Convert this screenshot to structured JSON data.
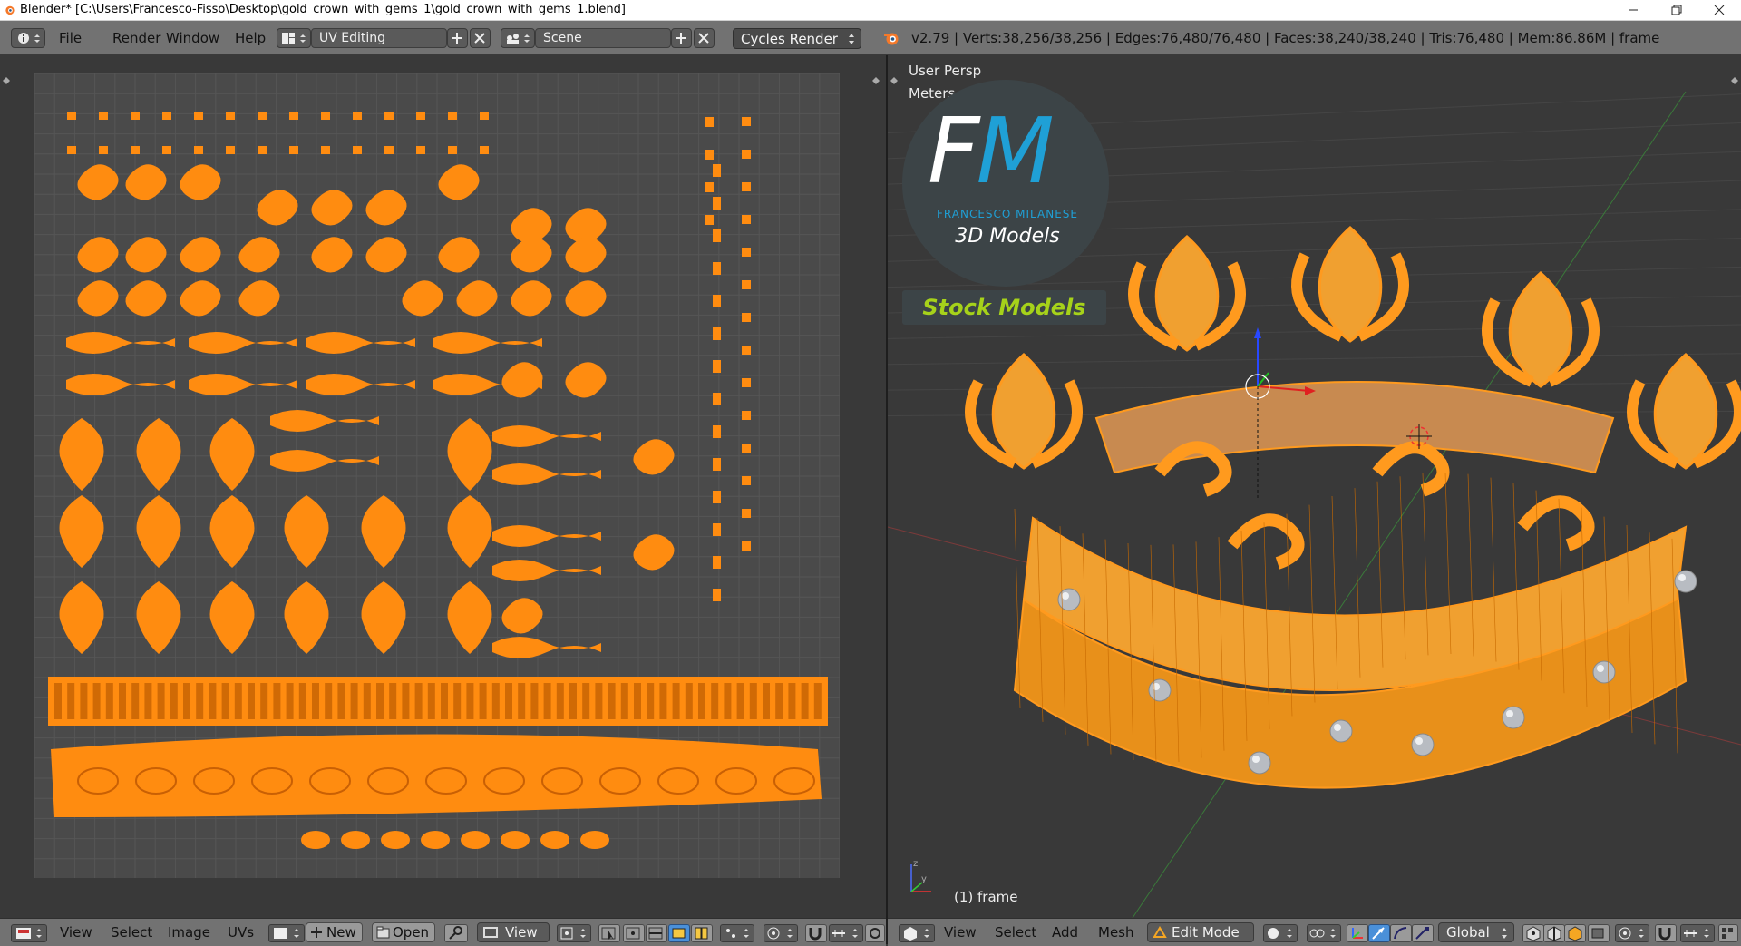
{
  "window": {
    "title": "Blender* [C:\\Users\\Francesco-Fisso\\Desktop\\gold_crown_with_gems_1\\gold_crown_with_gems_1.blend]"
  },
  "info_header": {
    "menus": [
      "File",
      "Render",
      "Window",
      "Help"
    ],
    "screen_layout": "UV Editing",
    "scene": "Scene",
    "render_engine": "Cycles Render",
    "stats": "v2.79 | Verts:38,256/38,256 | Edges:76,480/76,480 | Faces:38,240/38,240 | Tris:76,480 | Mem:86.86M | frame"
  },
  "viewport": {
    "view_name": "User Persp",
    "units": "Meters",
    "object_label": "(1) frame"
  },
  "watermark": {
    "letters_f": "F",
    "letters_m": "M",
    "author": "FRANCESCO MILANESE",
    "subtitle": "3D Models",
    "badge": "Stock Models"
  },
  "uv_footer": {
    "menus": [
      "View",
      "Select",
      "Image",
      "UVs"
    ],
    "new_label": "New",
    "open_label": "Open",
    "view_select": "View"
  },
  "view3d_footer": {
    "menus": [
      "View",
      "Select",
      "Add",
      "Mesh"
    ],
    "mode": "Edit Mode",
    "orientation": "Global"
  },
  "colors": {
    "uv_island": "#ff8c10",
    "mesh_wire": "#ff9a1e",
    "background": "#393939",
    "header": "#727272",
    "logo_blue": "#1fa0d6",
    "badge_green": "#a6d21a"
  }
}
